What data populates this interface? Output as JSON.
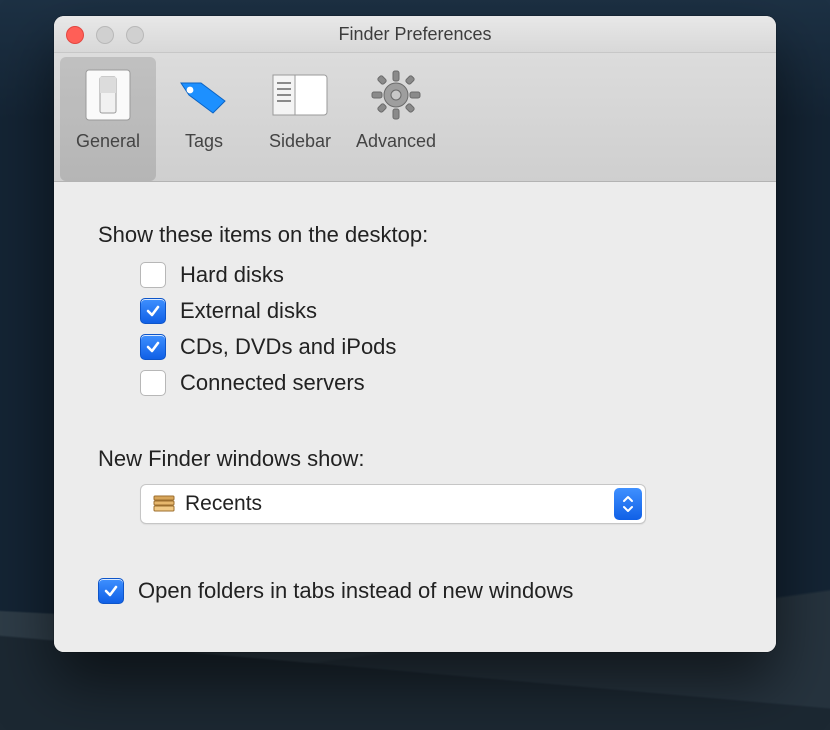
{
  "window": {
    "title": "Finder Preferences"
  },
  "tabs": [
    {
      "id": "general",
      "label": "General",
      "selected": true
    },
    {
      "id": "tags",
      "label": "Tags",
      "selected": false
    },
    {
      "id": "sidebar",
      "label": "Sidebar",
      "selected": false
    },
    {
      "id": "advanced",
      "label": "Advanced",
      "selected": false
    }
  ],
  "desktop_section": {
    "heading": "Show these items on the desktop:",
    "items": [
      {
        "label": "Hard disks",
        "checked": false
      },
      {
        "label": "External disks",
        "checked": true
      },
      {
        "label": "CDs, DVDs and iPods",
        "checked": true
      },
      {
        "label": "Connected servers",
        "checked": false
      }
    ]
  },
  "new_window_section": {
    "heading": "New Finder windows show:",
    "selected": "Recents"
  },
  "tabs_option": {
    "label": "Open folders in tabs instead of new windows",
    "checked": true
  }
}
